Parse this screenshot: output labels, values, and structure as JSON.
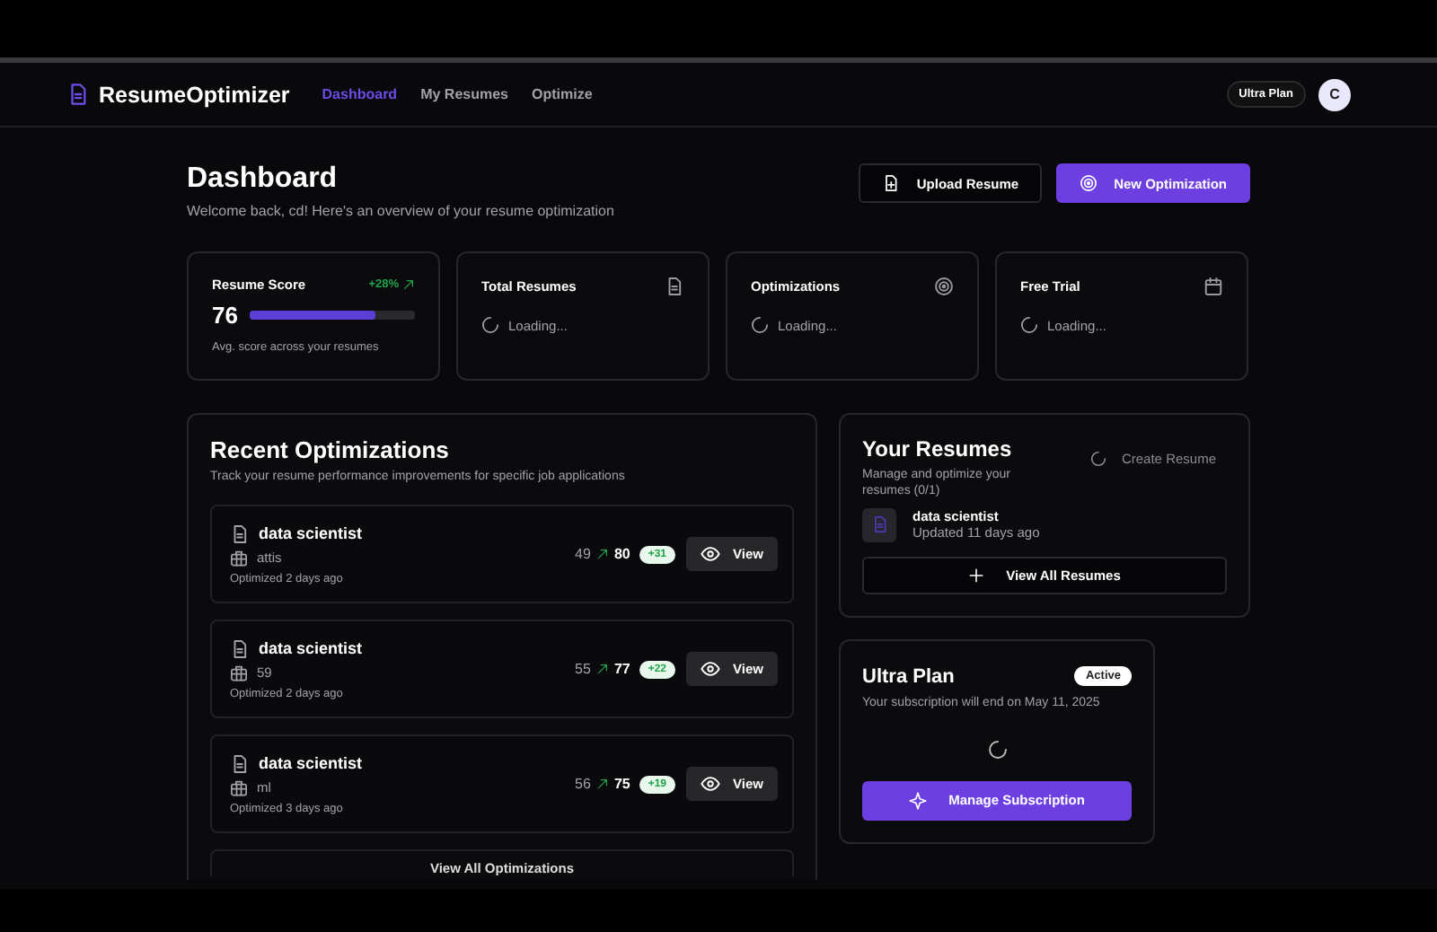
{
  "nav": {
    "brand": "ResumeOptimizer",
    "links": [
      {
        "label": "Dashboard",
        "selected": true
      },
      {
        "label": "My Resumes",
        "selected": false
      },
      {
        "label": "Optimize",
        "selected": false
      }
    ],
    "plan_badge": "Ultra Plan",
    "avatar_initial": "C"
  },
  "header": {
    "title": "Dashboard",
    "subtitle": "Welcome back, cd! Here's an overview of your resume optimization",
    "buttons": [
      {
        "label": "Upload Resume",
        "kind": "outline"
      },
      {
        "label": "New Optimization",
        "kind": "primary"
      }
    ]
  },
  "stats": [
    {
      "kind": "score",
      "title": "Resume Score",
      "change": "+28%",
      "value": "76",
      "level": 0.76,
      "caption": "Avg. score across your resumes"
    },
    {
      "kind": "loading",
      "title": "Total Resumes",
      "status": "Loading..."
    },
    {
      "kind": "loading",
      "title": "Optimizations",
      "status": "Loading..."
    },
    {
      "kind": "loading",
      "title": "Free Trial",
      "status": "Loading..."
    }
  ],
  "recent": {
    "title": "Recent Optimizations",
    "subtitle": "Track your resume performance improvements for specific job applications",
    "items": [
      {
        "job": "data scientist",
        "company": "attis",
        "time": "Optimized 2 days ago",
        "before": "49",
        "after": "80",
        "gain": "+31",
        "action": "View"
      },
      {
        "job": "data scientist",
        "company": "59",
        "time": "Optimized 2 days ago",
        "before": "55",
        "after": "77",
        "gain": "+22",
        "action": "View"
      },
      {
        "job": "data scientist",
        "company": "ml",
        "time": "Optimized 3 days ago",
        "before": "56",
        "after": "75",
        "gain": "+19",
        "action": "View"
      }
    ],
    "footer_link": "View All Optimizations"
  },
  "resumes": {
    "title": "Your Resumes",
    "subtitle": "Manage and optimize your resumes (0/1)",
    "create_button": "Create Resume",
    "items": [
      {
        "name": "data scientist",
        "updated": "Updated 11 days ago"
      }
    ],
    "view_all": "View All Resumes"
  },
  "plan": {
    "title": "Ultra Plan",
    "badge": "Active",
    "subtitle": "Your subscription will end on May 11, 2025",
    "button": "Manage Subscription"
  }
}
